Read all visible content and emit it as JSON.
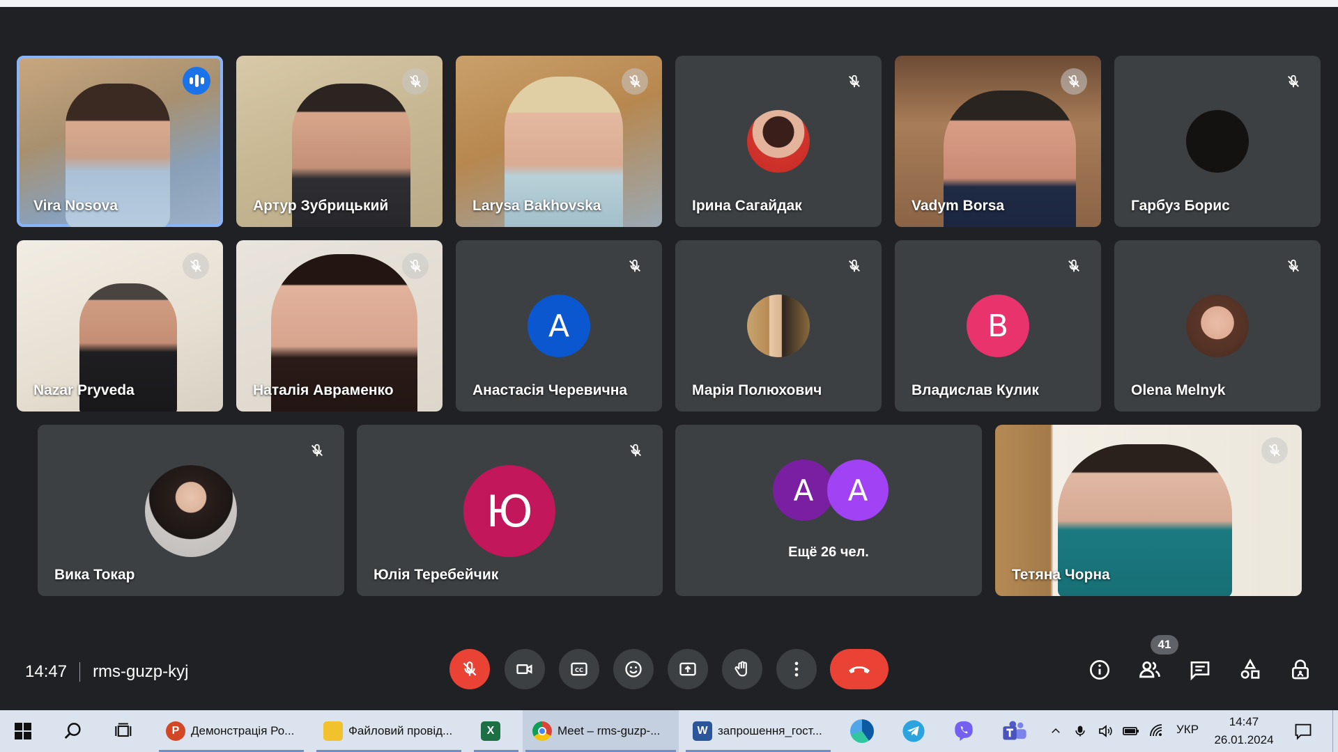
{
  "participants": [
    {
      "name": "Vira Nosova",
      "speaking": true
    },
    {
      "name": "Артур Зубрицький"
    },
    {
      "name": "Larysa Bakhovska"
    },
    {
      "name": "Ірина Сагайдак"
    },
    {
      "name": "Vadym Borsa"
    },
    {
      "name": "Гарбуз Борис"
    },
    {
      "name": "Nazar Pryveda"
    },
    {
      "name": "Наталія Авраменко"
    },
    {
      "name": "Анастасія Черевична",
      "initial": "А",
      "color": "#0b57d0"
    },
    {
      "name": "Марія Полюхович"
    },
    {
      "name": "Владислав Кулик",
      "initial": "В",
      "color": "#e8336d"
    },
    {
      "name": "Olena Melnyk"
    },
    {
      "name": "Вика Токар"
    },
    {
      "name": "Юлія Теребейчик",
      "initial": "Ю",
      "color": "#c2185b"
    },
    {
      "name": "Тетяна Чорна"
    }
  ],
  "others": {
    "avatars": [
      {
        "initial": "А",
        "color": "#7b1fa2"
      },
      {
        "initial": "А",
        "color": "#a142f4"
      }
    ],
    "label": "Ещё 26 чел."
  },
  "meeting": {
    "time": "14:47",
    "code": "rms-guzp-kyj",
    "participant_count": "41"
  },
  "controls": [
    "mic-off-icon",
    "camera-icon",
    "captions-icon",
    "emoji-icon",
    "present-icon",
    "raise-hand-icon",
    "more-options-icon",
    "end-call-icon"
  ],
  "right_controls": [
    "info-icon",
    "people-icon",
    "chat-icon",
    "activities-icon",
    "host-controls-icon"
  ],
  "taskbar": {
    "apps": [
      {
        "label": "Демонстрація Ро...",
        "icon": "powerpoint-icon"
      },
      {
        "label": "Файловий провід...",
        "icon": "file-explorer-icon"
      },
      {
        "label": "",
        "icon": "excel-icon"
      },
      {
        "label": "Meet – rms-guzp-...",
        "icon": "chrome-icon"
      },
      {
        "label": "запрошення_гост...",
        "icon": "word-icon"
      }
    ],
    "language": "УКР",
    "time": "14:47",
    "date": "26.01.2024"
  }
}
